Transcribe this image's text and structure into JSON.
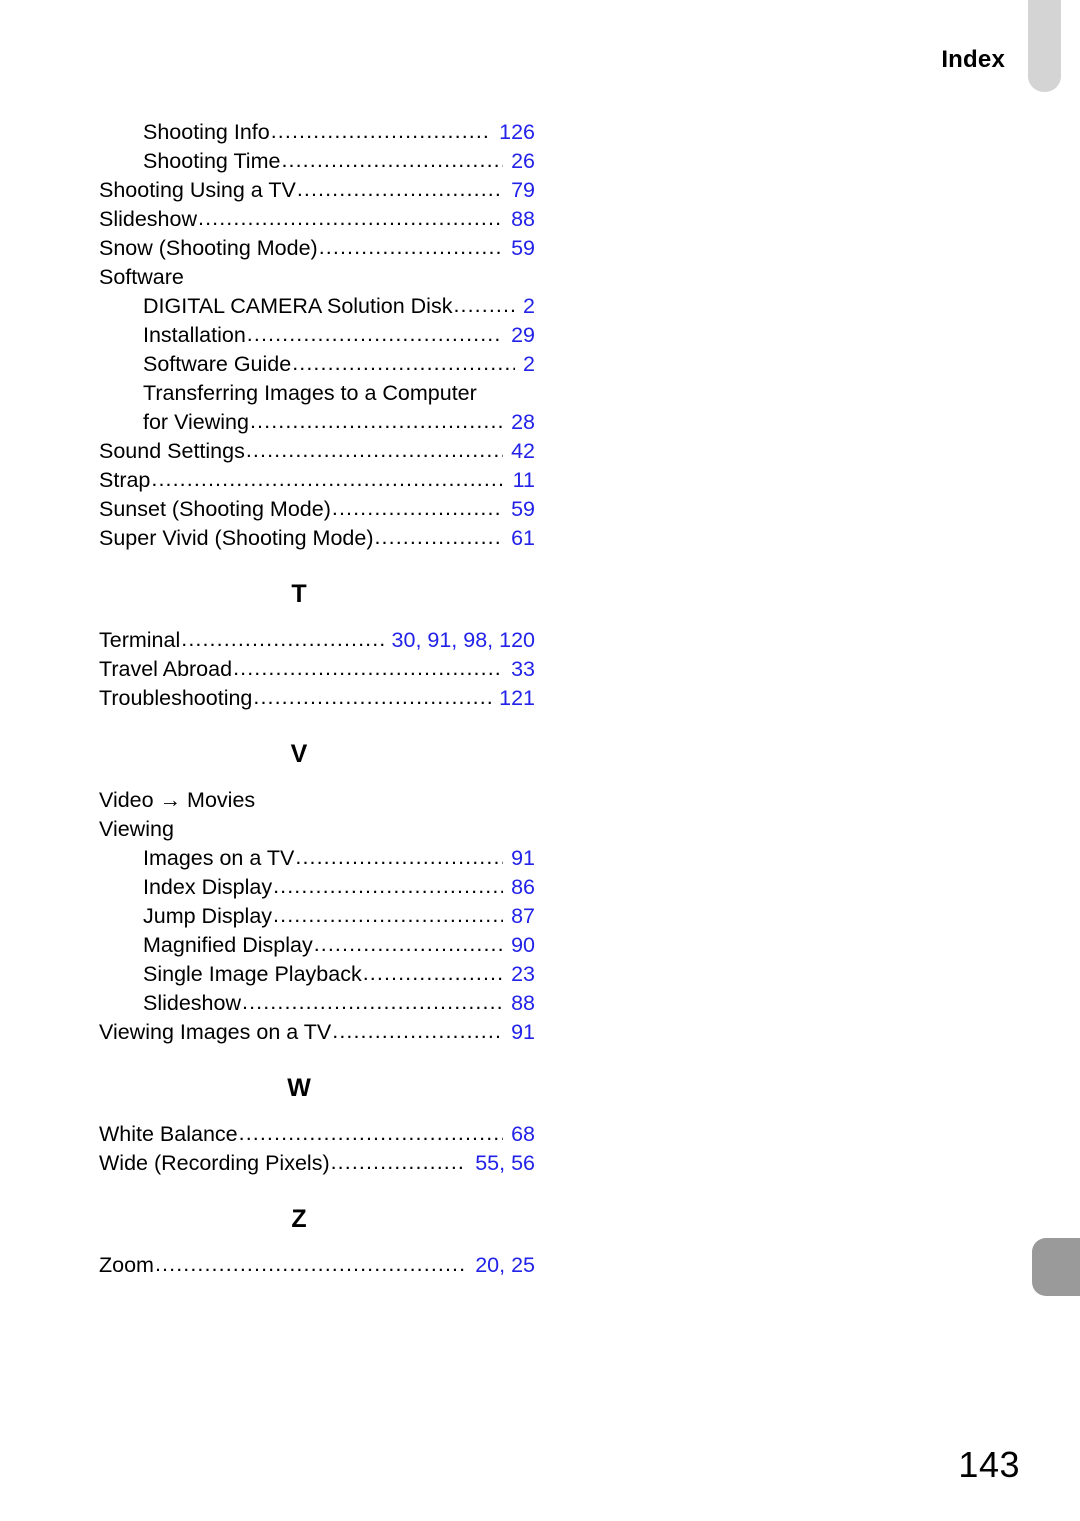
{
  "header": {
    "title": "Index"
  },
  "tabs": {
    "top_tab_color": "#d4d4d4",
    "bottom_tab_color": "#9a9a9a"
  },
  "colors": {
    "page_number_link": "#2222e8",
    "text": "#000000"
  },
  "page_footer": {
    "page_number": "143"
  },
  "sections": [
    {
      "letter": "",
      "show_letter": false,
      "entries": [
        {
          "label": "Shooting Info",
          "pages": "126",
          "indent": true,
          "leader": true
        },
        {
          "label": "Shooting Time",
          "pages": "26",
          "indent": true,
          "leader": true
        },
        {
          "label": "Shooting Using a TV",
          "pages": "79",
          "indent": false,
          "leader": true
        },
        {
          "label": "Slideshow",
          "pages": "88",
          "indent": false,
          "leader": true
        },
        {
          "label": "Snow (Shooting Mode)",
          "pages": "59",
          "indent": false,
          "leader": true
        },
        {
          "label": "Software",
          "pages": "",
          "indent": false,
          "leader": false
        },
        {
          "label": "DIGITAL CAMERA Solution Disk",
          "pages": "2",
          "indent": true,
          "leader": true
        },
        {
          "label": "Installation",
          "pages": "29",
          "indent": true,
          "leader": true
        },
        {
          "label": "Software Guide",
          "pages": "2",
          "indent": true,
          "leader": true
        },
        {
          "label": "Transferring Images to a Computer",
          "pages": "",
          "indent": true,
          "leader": false
        },
        {
          "label": "for Viewing",
          "pages": "28",
          "indent": true,
          "leader": true
        },
        {
          "label": "Sound Settings",
          "pages": "42",
          "indent": false,
          "leader": true
        },
        {
          "label": "Strap",
          "pages": "11",
          "indent": false,
          "leader": true
        },
        {
          "label": "Sunset (Shooting Mode)",
          "pages": "59",
          "indent": false,
          "leader": true
        },
        {
          "label": "Super Vivid (Shooting Mode)",
          "pages": "61",
          "indent": false,
          "leader": true
        }
      ]
    },
    {
      "letter": "T",
      "show_letter": true,
      "entries": [
        {
          "label": "Terminal",
          "pages": "30, 91, 98, 120",
          "indent": false,
          "leader": true
        },
        {
          "label": "Travel Abroad",
          "pages": "33",
          "indent": false,
          "leader": true
        },
        {
          "label": "Troubleshooting",
          "pages": "121",
          "indent": false,
          "leader": true
        }
      ]
    },
    {
      "letter": "V",
      "show_letter": true,
      "entries": [
        {
          "label": "Video → Movies",
          "pages": "",
          "indent": false,
          "leader": false
        },
        {
          "label": "Viewing",
          "pages": "",
          "indent": false,
          "leader": false
        },
        {
          "label": "Images on a TV",
          "pages": "91",
          "indent": true,
          "leader": true
        },
        {
          "label": "Index Display",
          "pages": "86",
          "indent": true,
          "leader": true
        },
        {
          "label": "Jump Display",
          "pages": "87",
          "indent": true,
          "leader": true
        },
        {
          "label": "Magnified Display",
          "pages": "90",
          "indent": true,
          "leader": true
        },
        {
          "label": "Single Image Playback",
          "pages": "23",
          "indent": true,
          "leader": true
        },
        {
          "label": "Slideshow",
          "pages": "88",
          "indent": true,
          "leader": true
        },
        {
          "label": "Viewing Images on a TV",
          "pages": "91",
          "indent": false,
          "leader": true
        }
      ]
    },
    {
      "letter": "W",
      "show_letter": true,
      "entries": [
        {
          "label": "White Balance",
          "pages": "68",
          "indent": false,
          "leader": true
        },
        {
          "label": "Wide (Recording Pixels)",
          "pages": "55, 56",
          "indent": false,
          "leader": true
        }
      ]
    },
    {
      "letter": "Z",
      "show_letter": true,
      "entries": [
        {
          "label": "Zoom",
          "pages": "20, 25",
          "indent": false,
          "leader": true
        }
      ]
    }
  ]
}
